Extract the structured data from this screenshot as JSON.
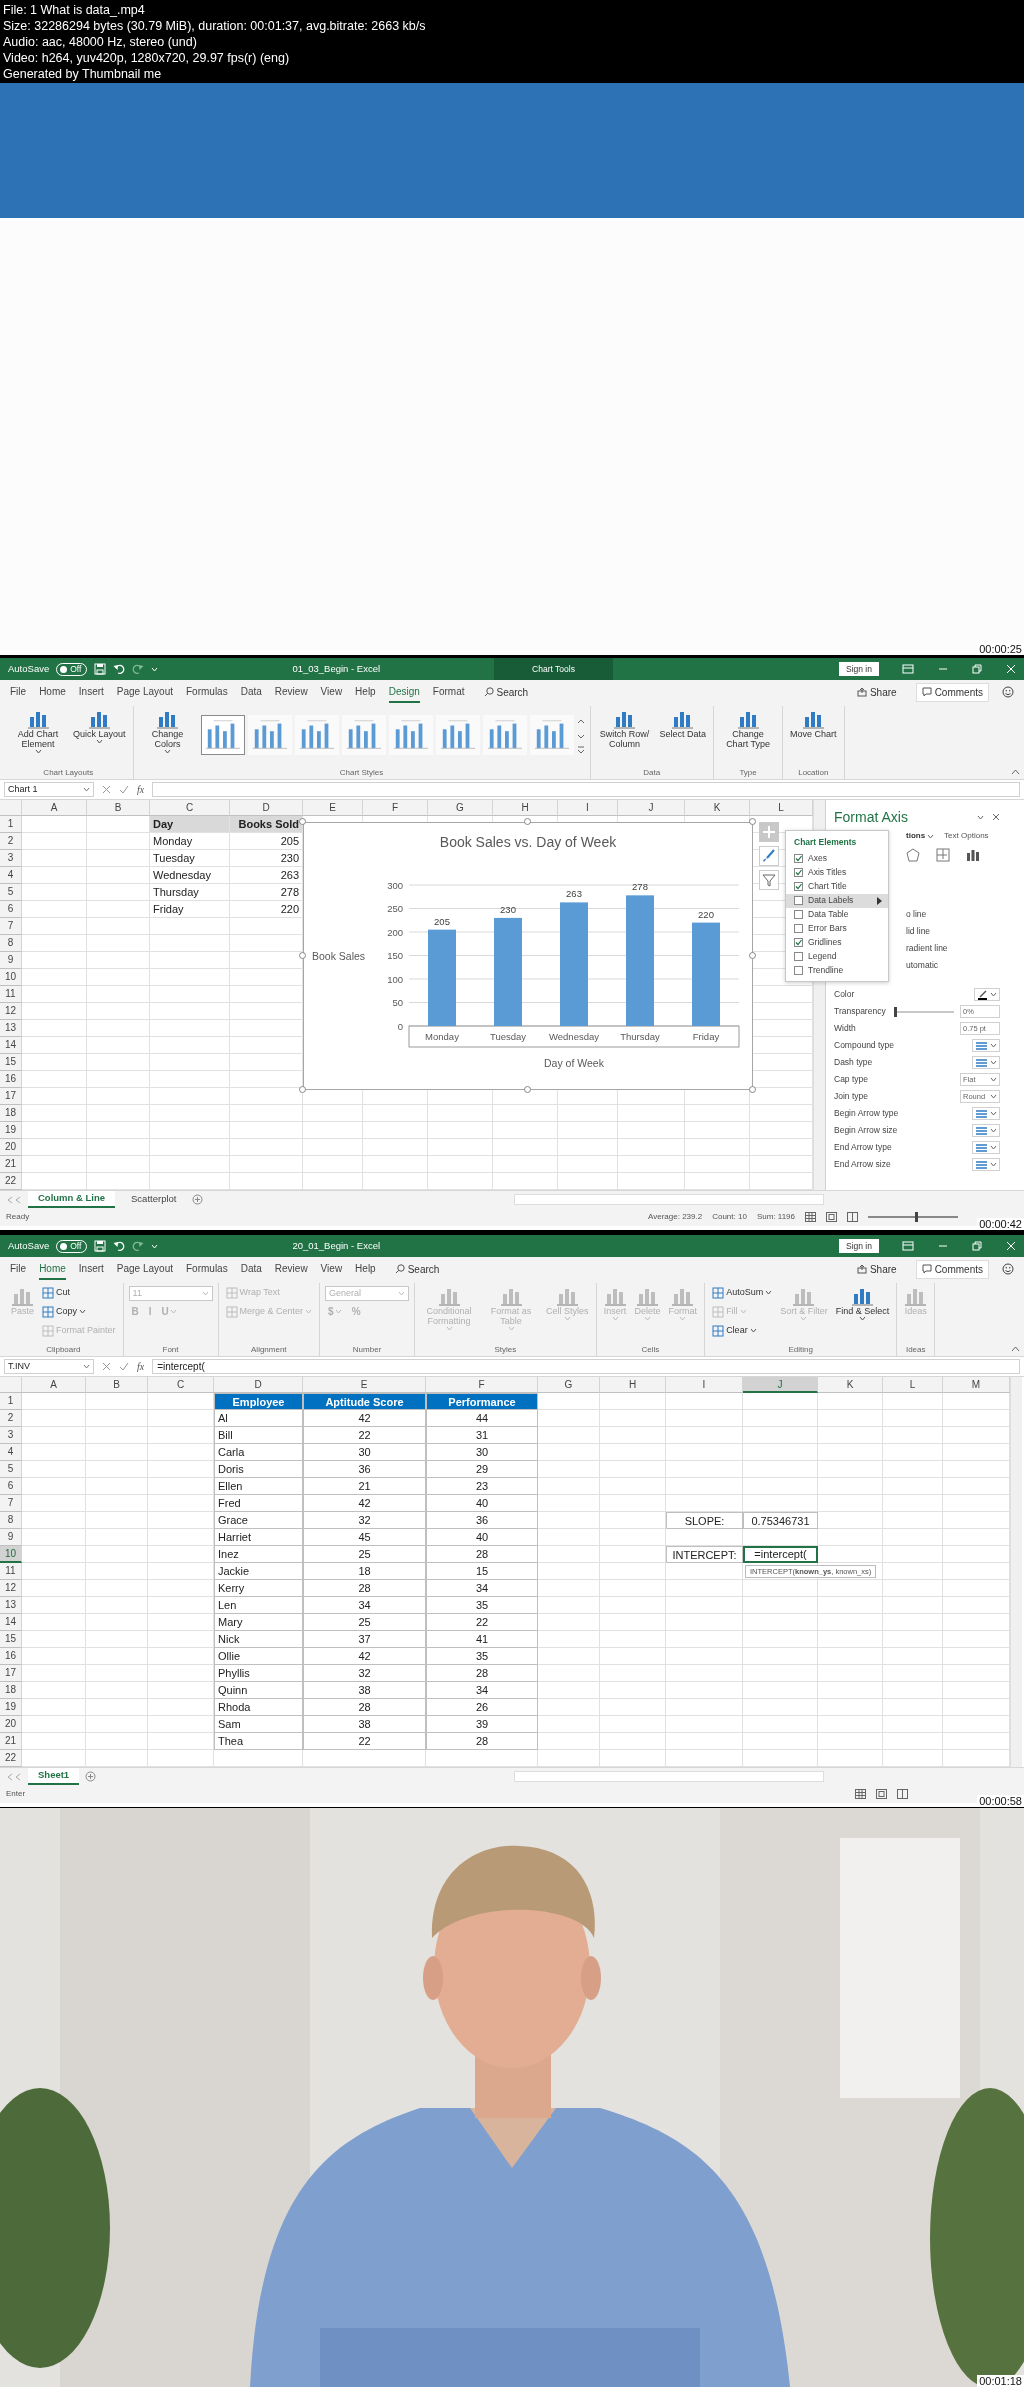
{
  "header": {
    "lines": [
      "File: 1 What is data_.mp4",
      "Size: 32286294 bytes (30.79 MiB), duration: 00:01:37, avg.bitrate: 2663 kb/s",
      "Audio: aac, 48000 Hz, stereo (und)",
      "Video: h264, yuv420p, 1280x720, 29.97 fps(r) (eng)",
      "Generated by Thumbnail me"
    ]
  },
  "frames": [
    {
      "kind": "slide",
      "timestamp": "00:00:25"
    },
    {
      "kind": "excel_chart",
      "timestamp": "00:00:42",
      "title_bar": {
        "autosave_label": "AutoSave",
        "autosave_state": "Off",
        "autosave_on": false,
        "file_title": "01_03_Begin  -  Excel",
        "context_tab": "Chart Tools",
        "sign_in": "Sign in"
      },
      "menu_tabs": [
        {
          "label": "File",
          "selected": false
        },
        {
          "label": "Home",
          "selected": false
        },
        {
          "label": "Insert",
          "selected": false
        },
        {
          "label": "Page Layout",
          "selected": false
        },
        {
          "label": "Formulas",
          "selected": false
        },
        {
          "label": "Data",
          "selected": false
        },
        {
          "label": "Review",
          "selected": false
        },
        {
          "label": "View",
          "selected": false
        },
        {
          "label": "Help",
          "selected": false
        },
        {
          "label": "Design",
          "selected": true
        },
        {
          "label": "Format",
          "selected": false
        }
      ],
      "search": "Search",
      "share": "Share",
      "comments": "Comments",
      "ribbon": [
        {
          "label": "Chart Layouts",
          "kind": "columns",
          "items": [
            {
              "label": "Add Chart Element",
              "kind": "large",
              "dropdown": true,
              "disabled": false
            },
            {
              "label": "Quick Layout",
              "kind": "large",
              "dropdown": true,
              "disabled": false
            }
          ]
        },
        {
          "label": "Chart Styles",
          "kind": "columns",
          "items": [
            {
              "label": "Change Colors",
              "kind": "large",
              "dropdown": true,
              "disabled": false
            }
          ],
          "gallery": [
            {
              "selected": true
            },
            {
              "selected": false
            },
            {
              "selected": false
            },
            {
              "selected": false
            },
            {
              "selected": false
            },
            {
              "selected": false
            },
            {
              "selected": false
            },
            {
              "selected": false
            }
          ]
        },
        {
          "label": "Data",
          "kind": "columns",
          "items": [
            {
              "label": "Switch Row/ Column",
              "kind": "large",
              "dropdown": false,
              "disabled": false
            },
            {
              "label": "Select Data",
              "kind": "large",
              "dropdown": false,
              "disabled": false
            }
          ]
        },
        {
          "label": "Type",
          "kind": "columns",
          "items": [
            {
              "label": "Change Chart Type",
              "kind": "large",
              "dropdown": false,
              "disabled": false
            }
          ]
        },
        {
          "label": "Location",
          "kind": "columns",
          "items": [
            {
              "label": "Move Chart",
              "kind": "large",
              "dropdown": false,
              "disabled": false
            }
          ]
        }
      ],
      "formula_bar": {
        "name_box": "Chart 1",
        "fx": "fx"
      },
      "columns": [
        {
          "label": "A",
          "selected": false
        },
        {
          "label": "B",
          "selected": false
        },
        {
          "label": "C",
          "selected": false
        },
        {
          "label": "D",
          "selected": false
        },
        {
          "label": "E",
          "selected": false
        },
        {
          "label": "F",
          "selected": false
        },
        {
          "label": "G",
          "selected": false
        },
        {
          "label": "H",
          "selected": false
        },
        {
          "label": "I",
          "selected": false
        },
        {
          "label": "J",
          "selected": false
        },
        {
          "label": "K",
          "selected": false
        },
        {
          "label": "L",
          "selected": false
        }
      ],
      "rows": [
        {
          "label": "1",
          "selected": false
        },
        {
          "label": "2",
          "selected": false
        },
        {
          "label": "3",
          "selected": false
        },
        {
          "label": "4",
          "selected": false
        },
        {
          "label": "5",
          "selected": false
        },
        {
          "label": "6",
          "selected": false
        },
        {
          "label": "7",
          "selected": false
        },
        {
          "label": "8",
          "selected": false
        },
        {
          "label": "9",
          "selected": false
        },
        {
          "label": "10",
          "selected": false
        },
        {
          "label": "11",
          "selected": false
        },
        {
          "label": "12",
          "selected": false
        },
        {
          "label": "13",
          "selected": false
        },
        {
          "label": "14",
          "selected": false
        },
        {
          "label": "15",
          "selected": false
        },
        {
          "label": "16",
          "selected": false
        },
        {
          "label": "17",
          "selected": false
        },
        {
          "label": "18",
          "selected": false
        },
        {
          "label": "19",
          "selected": false
        },
        {
          "label": "20",
          "selected": false
        },
        {
          "label": "21",
          "selected": false
        },
        {
          "label": "22",
          "selected": false
        }
      ],
      "table": {
        "kind": "grey_header",
        "columns": [
          "Day",
          "Books Sold"
        ],
        "rows": [
          [
            "Monday",
            "205"
          ],
          [
            "Tuesday",
            "230"
          ],
          [
            "Wednesday",
            "263"
          ],
          [
            "Thursday",
            "278"
          ],
          [
            "Friday",
            "220"
          ]
        ]
      },
      "chart": {
        "chart_data": {
          "type": "bar",
          "title": "Book Sales vs. Day of Week",
          "xlabel": "Day of Week",
          "ylabel": "Book Sales",
          "categories": [
            "Monday",
            "Tuesday",
            "Wednesday",
            "Thursday",
            "Friday"
          ],
          "series": [
            {
              "color": "#5b9bd5",
              "values": [
                205,
                230,
                263,
                278,
                220
              ]
            }
          ],
          "ylim": [
            0,
            300
          ],
          "yticks": [
            0,
            50,
            100,
            150,
            200,
            250,
            300
          ],
          "grid": true,
          "data_labels": true
        }
      },
      "chart_elements": {
        "title": "Chart Elements",
        "items": [
          {
            "label": "Axes",
            "checked": true,
            "selected": false
          },
          {
            "label": "Axis Titles",
            "checked": true,
            "selected": false
          },
          {
            "label": "Chart Title",
            "checked": true,
            "selected": false
          },
          {
            "label": "Data Labels",
            "checked": false,
            "selected": true
          },
          {
            "label": "Data Table",
            "checked": false,
            "selected": false
          },
          {
            "label": "Error Bars",
            "checked": false,
            "selected": false
          },
          {
            "label": "Gridlines",
            "checked": true,
            "selected": false
          },
          {
            "label": "Legend",
            "checked": false,
            "selected": false
          },
          {
            "label": "Trendline",
            "checked": false,
            "selected": false
          }
        ]
      },
      "format_pane": {
        "title": "Format Axis",
        "tabs": [
          {
            "label": "tions",
            "selected": true
          },
          {
            "label": "Text Options",
            "selected": false
          }
        ],
        "options": [
          "o line",
          "lid line",
          "radient line",
          "utomatic"
        ],
        "properties": [
          {
            "label": "Color",
            "kind": "color"
          },
          {
            "label": "Transparency",
            "kind": "slider",
            "level": 0,
            "value": "0%"
          },
          {
            "label": "Width",
            "kind": "spin",
            "value": "0.75 pt"
          },
          {
            "label": "Compound type",
            "kind": "style"
          },
          {
            "label": "Dash type",
            "kind": "style"
          },
          {
            "label": "Cap type",
            "kind": "dropdown",
            "value": "Flat"
          },
          {
            "label": "Join type",
            "kind": "dropdown",
            "value": "Round"
          },
          {
            "label": "Begin Arrow type",
            "kind": "style"
          },
          {
            "label": "Begin Arrow size",
            "kind": "style"
          },
          {
            "label": "End Arrow type",
            "kind": "style"
          },
          {
            "label": "End Arrow size",
            "kind": "style"
          }
        ]
      },
      "sheet_tabs": [
        {
          "label": "Column & Line",
          "selected": true
        },
        {
          "label": "Scatterplot",
          "selected": false
        }
      ],
      "status": {
        "mode": "Ready",
        "stats": [
          "Average: 239.2",
          "Count: 10",
          "Sum: 1196"
        ],
        "zoom_slider": {
          "level": 0.52
        }
      }
    },
    {
      "kind": "excel_table",
      "timestamp": "00:00:58",
      "title_bar": {
        "autosave_label": "AutoSave",
        "autosave_state": "Off",
        "autosave_on": false,
        "file_title": "20_01_Begin  -  Excel",
        "sign_in": "Sign in"
      },
      "menu_tabs": [
        {
          "label": "File",
          "selected": false
        },
        {
          "label": "Home",
          "selected": true
        },
        {
          "label": "Insert",
          "selected": false
        },
        {
          "label": "Page Layout",
          "selected": false
        },
        {
          "label": "Formulas",
          "selected": false
        },
        {
          "label": "Data",
          "selected": false
        },
        {
          "label": "Review",
          "selected": false
        },
        {
          "label": "View",
          "selected": false
        },
        {
          "label": "Help",
          "selected": false
        }
      ],
      "search": "Search",
      "share": "Share",
      "comments": "Comments",
      "ribbon": [
        {
          "label": "Clipboard",
          "kind": "columns",
          "items": [
            {
              "label": "Paste",
              "kind": "large",
              "dropdown": false,
              "disabled": true
            },
            {
              "label": "Cut",
              "kind": "small",
              "dropdown": false,
              "disabled": false
            },
            {
              "label": "Copy",
              "kind": "small",
              "dropdown": true,
              "disabled": false
            },
            {
              "label": "Format Painter",
              "kind": "small",
              "dropdown": false,
              "disabled": true
            }
          ]
        },
        {
          "label": "Font",
          "kind": "rows",
          "items": [
            {
              "label": "11",
              "kind": "field",
              "dropdown": true,
              "disabled": true
            },
            {
              "label": "B",
              "kind": "glyph",
              "dropdown": false,
              "disabled": true
            },
            {
              "label": "I",
              "kind": "glyph",
              "dropdown": false,
              "disabled": true
            },
            {
              "label": "U",
              "kind": "glyph",
              "dropdown": true,
              "disabled": true
            }
          ]
        },
        {
          "label": "Alignment",
          "kind": "columns",
          "items": [
            {
              "label": "Wrap Text",
              "kind": "small",
              "dropdown": false,
              "disabled": true
            },
            {
              "label": "Merge & Center",
              "kind": "small",
              "dropdown": true,
              "disabled": true
            }
          ]
        },
        {
          "label": "Number",
          "kind": "rows",
          "items": [
            {
              "label": "General",
              "kind": "field",
              "dropdown": true,
              "disabled": true
            },
            {
              "label": "$",
              "kind": "glyph",
              "dropdown": true,
              "disabled": true
            },
            {
              "label": "%",
              "kind": "glyph",
              "dropdown": false,
              "disabled": true
            }
          ]
        },
        {
          "label": "Styles",
          "kind": "columns",
          "items": [
            {
              "label": "Conditional Formatting",
              "kind": "large",
              "dropdown": true,
              "disabled": true
            },
            {
              "label": "Format as Table",
              "kind": "large",
              "dropdown": true,
              "disabled": true
            },
            {
              "label": "Cell Styles",
              "kind": "large",
              "dropdown": true,
              "disabled": true
            }
          ]
        },
        {
          "label": "Cells",
          "kind": "columns",
          "items": [
            {
              "label": "Insert",
              "kind": "large",
              "dropdown": true,
              "disabled": true
            },
            {
              "label": "Delete",
              "kind": "large",
              "dropdown": true,
              "disabled": true
            },
            {
              "label": "Format",
              "kind": "large",
              "dropdown": true,
              "disabled": true
            }
          ]
        },
        {
          "label": "Editing",
          "kind": "columns",
          "items": [
            {
              "label": "AutoSum",
              "kind": "small",
              "dropdown": true,
              "disabled": false
            },
            {
              "label": "Fill",
              "kind": "small",
              "dropdown": true,
              "disabled": true
            },
            {
              "label": "Clear",
              "kind": "small",
              "dropdown": true,
              "disabled": false
            },
            {
              "label": "Sort & Filter",
              "kind": "large",
              "dropdown": true,
              "disabled": true
            },
            {
              "label": "Find & Select",
              "kind": "large",
              "dropdown": true,
              "disabled": false
            }
          ]
        },
        {
          "label": "Ideas",
          "kind": "columns",
          "items": [
            {
              "label": "Ideas",
              "kind": "large",
              "dropdown": false,
              "disabled": true
            }
          ]
        }
      ],
      "formula_bar": {
        "name_box": "T.INV",
        "fx": "fx",
        "formula": "=intercept("
      },
      "columns": [
        {
          "label": "A",
          "selected": false
        },
        {
          "label": "B",
          "selected": false
        },
        {
          "label": "C",
          "selected": false
        },
        {
          "label": "D",
          "selected": false
        },
        {
          "label": "E",
          "selected": false
        },
        {
          "label": "F",
          "selected": false
        },
        {
          "label": "G",
          "selected": false
        },
        {
          "label": "H",
          "selected": false
        },
        {
          "label": "I",
          "selected": false
        },
        {
          "label": "J",
          "selected": true
        },
        {
          "label": "K",
          "selected": false
        },
        {
          "label": "L",
          "selected": false
        },
        {
          "label": "M",
          "selected": false
        }
      ],
      "rows": [
        {
          "label": "1",
          "selected": false
        },
        {
          "label": "2",
          "selected": false
        },
        {
          "label": "3",
          "selected": false
        },
        {
          "label": "4",
          "selected": false
        },
        {
          "label": "5",
          "selected": false
        },
        {
          "label": "6",
          "selected": false
        },
        {
          "label": "7",
          "selected": false
        },
        {
          "label": "8",
          "selected": false
        },
        {
          "label": "9",
          "selected": false
        },
        {
          "label": "10",
          "selected": true
        },
        {
          "label": "11",
          "selected": false
        },
        {
          "label": "12",
          "selected": false
        },
        {
          "label": "13",
          "selected": false
        },
        {
          "label": "14",
          "selected": false
        },
        {
          "label": "15",
          "selected": false
        },
        {
          "label": "16",
          "selected": false
        },
        {
          "label": "17",
          "selected": false
        },
        {
          "label": "18",
          "selected": false
        },
        {
          "label": "19",
          "selected": false
        },
        {
          "label": "20",
          "selected": false
        },
        {
          "label": "21",
          "selected": false
        },
        {
          "label": "22",
          "selected": false
        }
      ],
      "table": {
        "kind": "blue_header",
        "columns": [
          "Employee",
          "Aptitude Score",
          "Performance"
        ],
        "rows": [
          [
            "Al",
            "42",
            "44"
          ],
          [
            "Bill",
            "22",
            "31"
          ],
          [
            "Carla",
            "30",
            "30"
          ],
          [
            "Doris",
            "36",
            "29"
          ],
          [
            "Ellen",
            "21",
            "23"
          ],
          [
            "Fred",
            "42",
            "40"
          ],
          [
            "Grace",
            "32",
            "36"
          ],
          [
            "Harriet",
            "45",
            "40"
          ],
          [
            "Inez",
            "25",
            "28"
          ],
          [
            "Jackie",
            "18",
            "15"
          ],
          [
            "Kerry",
            "28",
            "34"
          ],
          [
            "Len",
            "34",
            "35"
          ],
          [
            "Mary",
            "25",
            "22"
          ],
          [
            "Nick",
            "37",
            "41"
          ],
          [
            "Ollie",
            "42",
            "35"
          ],
          [
            "Phyllis",
            "32",
            "28"
          ],
          [
            "Quinn",
            "38",
            "34"
          ],
          [
            "Rhoda",
            "28",
            "26"
          ],
          [
            "Sam",
            "38",
            "39"
          ],
          [
            "Thea",
            "22",
            "28"
          ]
        ]
      },
      "calc": [
        {
          "label": "SLOPE:",
          "value": "0.75346731",
          "editing": false
        },
        {
          "label": "INTERCEPT:",
          "value": "=intercept(",
          "editing": true
        }
      ],
      "tooltip": "INTERCEPT(**known_ys**, known_xs)",
      "sheet_tabs": [
        {
          "label": "Sheet1",
          "selected": true
        }
      ],
      "status": {
        "mode": "Enter"
      }
    },
    {
      "kind": "video",
      "timestamp": "00:01:18"
    }
  ]
}
